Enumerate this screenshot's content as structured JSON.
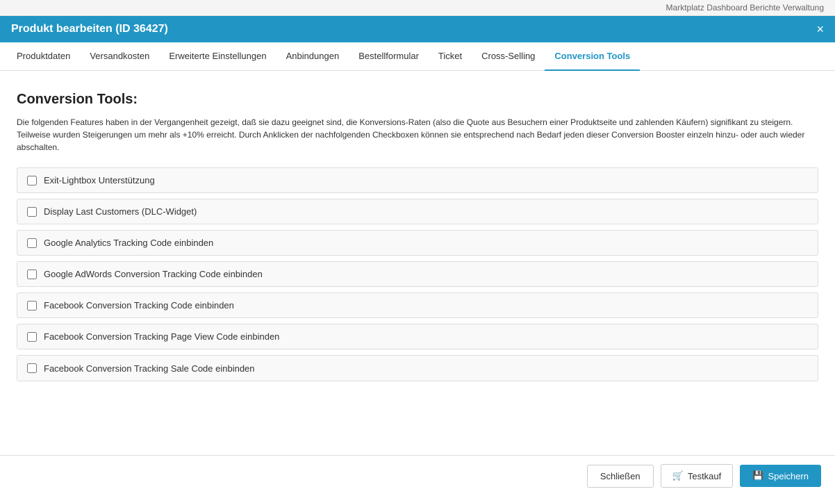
{
  "modal": {
    "title": "Produkt bearbeiten (ID 36427)",
    "close_label": "×"
  },
  "topbar": {
    "hint": "Marktplatz   Dashboard   Berichte   Verwaltung"
  },
  "tabs": [
    {
      "id": "produktdaten",
      "label": "Produktdaten",
      "active": false
    },
    {
      "id": "versandkosten",
      "label": "Versandkosten",
      "active": false
    },
    {
      "id": "erweiterte",
      "label": "Erweiterte Einstellungen",
      "active": false
    },
    {
      "id": "anbindungen",
      "label": "Anbindungen",
      "active": false
    },
    {
      "id": "bestellformular",
      "label": "Bestellformular",
      "active": false
    },
    {
      "id": "ticket",
      "label": "Ticket",
      "active": false
    },
    {
      "id": "crossselling",
      "label": "Cross-Selling",
      "active": false
    },
    {
      "id": "conversiontools",
      "label": "Conversion Tools",
      "active": true
    }
  ],
  "content": {
    "section_title": "Conversion Tools:",
    "section_desc": "Die folgenden Features haben in der Vergangenheit gezeigt, daß sie dazu geeignet sind, die Konversions-Raten (also die Quote aus Besuchern einer Produktseite und zahlenden Käufern) signifikant zu steigern. Teilweise wurden Steigerungen um mehr als +10% erreicht. Durch Anklicken der nachfolgenden Checkboxen können sie entsprechend nach Bedarf jeden dieser Conversion Booster einzeln hinzu- oder auch wieder abschalten.",
    "checkboxes": [
      {
        "id": "cb1",
        "label": "Exit-Lightbox Unterstützung",
        "checked": false
      },
      {
        "id": "cb2",
        "label": "Display Last Customers (DLC-Widget)",
        "checked": false
      },
      {
        "id": "cb3",
        "label": "Google Analytics Tracking Code einbinden",
        "checked": false
      },
      {
        "id": "cb4",
        "label": "Google AdWords Conversion Tracking Code einbinden",
        "checked": false
      },
      {
        "id": "cb5",
        "label": "Facebook Conversion Tracking Code einbinden",
        "checked": false
      },
      {
        "id": "cb6",
        "label": "Facebook Conversion Tracking Page View Code einbinden",
        "checked": false
      },
      {
        "id": "cb7",
        "label": "Facebook Conversion Tracking Sale Code einbinden",
        "checked": false
      }
    ]
  },
  "footer": {
    "close_label": "Schließen",
    "test_label": "Testkauf",
    "save_label": "Speichern",
    "cart_icon": "🛒",
    "save_icon": "💾"
  }
}
